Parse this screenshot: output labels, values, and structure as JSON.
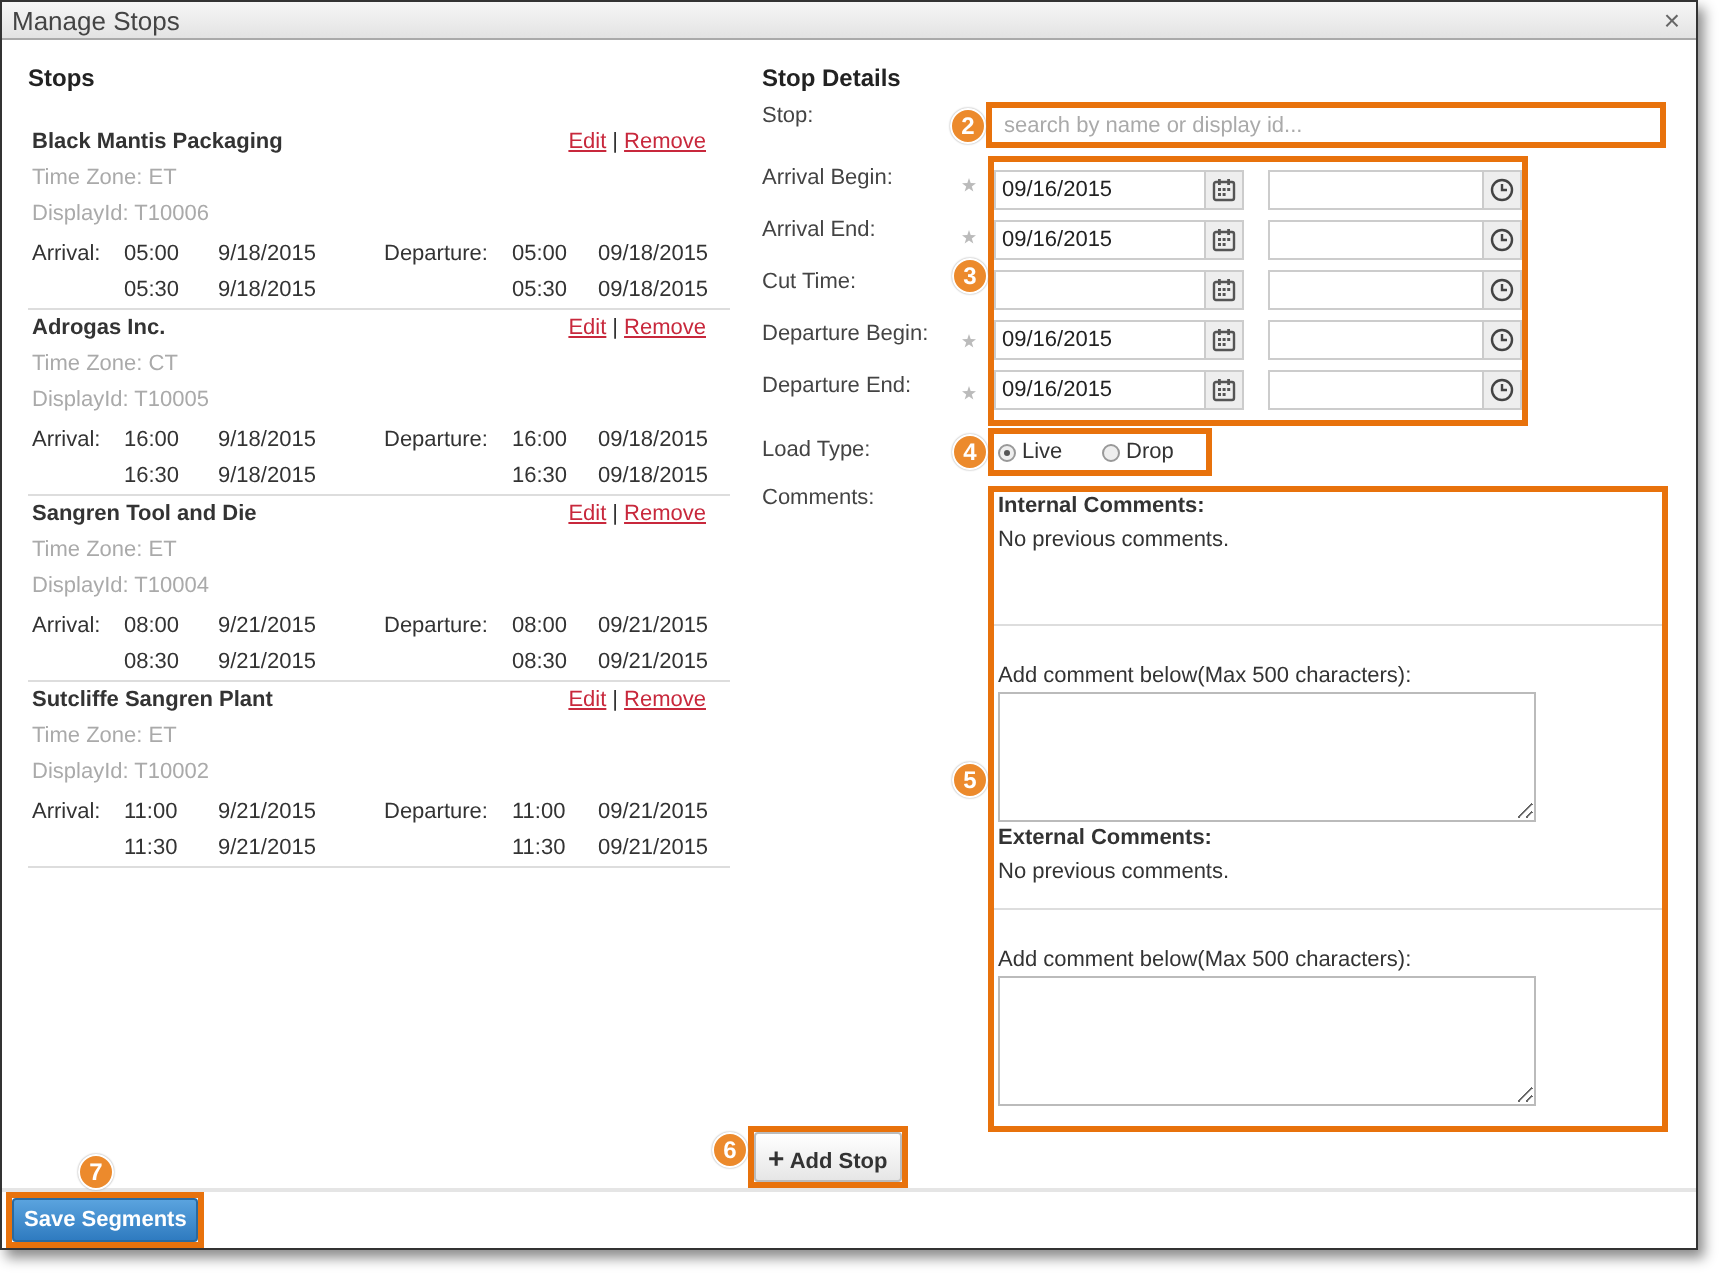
{
  "window": {
    "title": "Manage Stops",
    "close": "×"
  },
  "stops_panel": {
    "title": "Stops",
    "stops": [
      {
        "name": "Black Mantis Packaging",
        "edit": "Edit",
        "separator": "|",
        "remove": "Remove",
        "time_zone": "Time Zone: ET",
        "display_id": "DisplayId: T10006",
        "arrival_label": "Arrival:",
        "departure_label": "Departure:",
        "times": [
          {
            "arrival_time": "05:00",
            "arrival_date": "9/18/2015",
            "departure_time": "05:00",
            "departure_date": "09/18/2015"
          },
          {
            "arrival_time": "05:30",
            "arrival_date": "9/18/2015",
            "departure_time": "05:30",
            "departure_date": "09/18/2015"
          }
        ]
      },
      {
        "name": "Adrogas Inc.",
        "edit": "Edit",
        "separator": "|",
        "remove": "Remove",
        "time_zone": "Time Zone: CT",
        "display_id": "DisplayId: T10005",
        "arrival_label": "Arrival:",
        "departure_label": "Departure:",
        "times": [
          {
            "arrival_time": "16:00",
            "arrival_date": "9/18/2015",
            "departure_time": "16:00",
            "departure_date": "09/18/2015"
          },
          {
            "arrival_time": "16:30",
            "arrival_date": "9/18/2015",
            "departure_time": "16:30",
            "departure_date": "09/18/2015"
          }
        ]
      },
      {
        "name": "Sangren Tool and Die",
        "edit": "Edit",
        "separator": "|",
        "remove": "Remove",
        "time_zone": "Time Zone: ET",
        "display_id": "DisplayId: T10004",
        "arrival_label": "Arrival:",
        "departure_label": "Departure:",
        "times": [
          {
            "arrival_time": "08:00",
            "arrival_date": "9/21/2015",
            "departure_time": "08:00",
            "departure_date": "09/21/2015"
          },
          {
            "arrival_time": "08:30",
            "arrival_date": "9/21/2015",
            "departure_time": "08:30",
            "departure_date": "09/21/2015"
          }
        ]
      },
      {
        "name": "Sutcliffe Sangren Plant",
        "edit": "Edit",
        "separator": "|",
        "remove": "Remove",
        "time_zone": "Time Zone: ET",
        "display_id": "DisplayId: T10002",
        "arrival_label": "Arrival:",
        "departure_label": "Departure:",
        "times": [
          {
            "arrival_time": "11:00",
            "arrival_date": "9/21/2015",
            "departure_time": "11:00",
            "departure_date": "09/21/2015"
          },
          {
            "arrival_time": "11:30",
            "arrival_date": "9/21/2015",
            "departure_time": "11:30",
            "departure_date": "09/21/2015"
          }
        ]
      }
    ]
  },
  "details": {
    "title": "Stop Details",
    "stop": {
      "label": "Stop:",
      "placeholder": "search by name or display id...",
      "callout": "2"
    },
    "schedule": {
      "callout": "3",
      "rows": [
        {
          "label": "Arrival Begin:",
          "required": true,
          "date": "09/16/2015"
        },
        {
          "label": "Arrival End:",
          "required": true,
          "date": "09/16/2015"
        },
        {
          "label": "Cut Time:",
          "required": false
        },
        {
          "label": "Departure Begin:",
          "required": true,
          "date": "09/16/2015"
        },
        {
          "label": "Departure End:",
          "required": true,
          "date": "09/16/2015"
        }
      ]
    },
    "load_type": {
      "label": "Load Type:",
      "callout": "4",
      "options": [
        {
          "label": "Live",
          "selected": true
        },
        {
          "label": "Drop",
          "selected": false
        }
      ]
    },
    "comments": {
      "label": "Comments:",
      "callout": "5",
      "sections": [
        {
          "title": "Internal Comments:",
          "text": "No previous comments.",
          "add_label": "Add comment below(Max 500 characters):"
        },
        {
          "title": "External Comments:",
          "text": "No previous comments.",
          "add_label": "Add comment below(Max 500 characters):"
        }
      ]
    },
    "add_stop": {
      "icon": "+",
      "label": "Add Stop",
      "callout": "6"
    }
  },
  "footer": {
    "save": {
      "label": "Save Segments",
      "callout": "7"
    }
  }
}
